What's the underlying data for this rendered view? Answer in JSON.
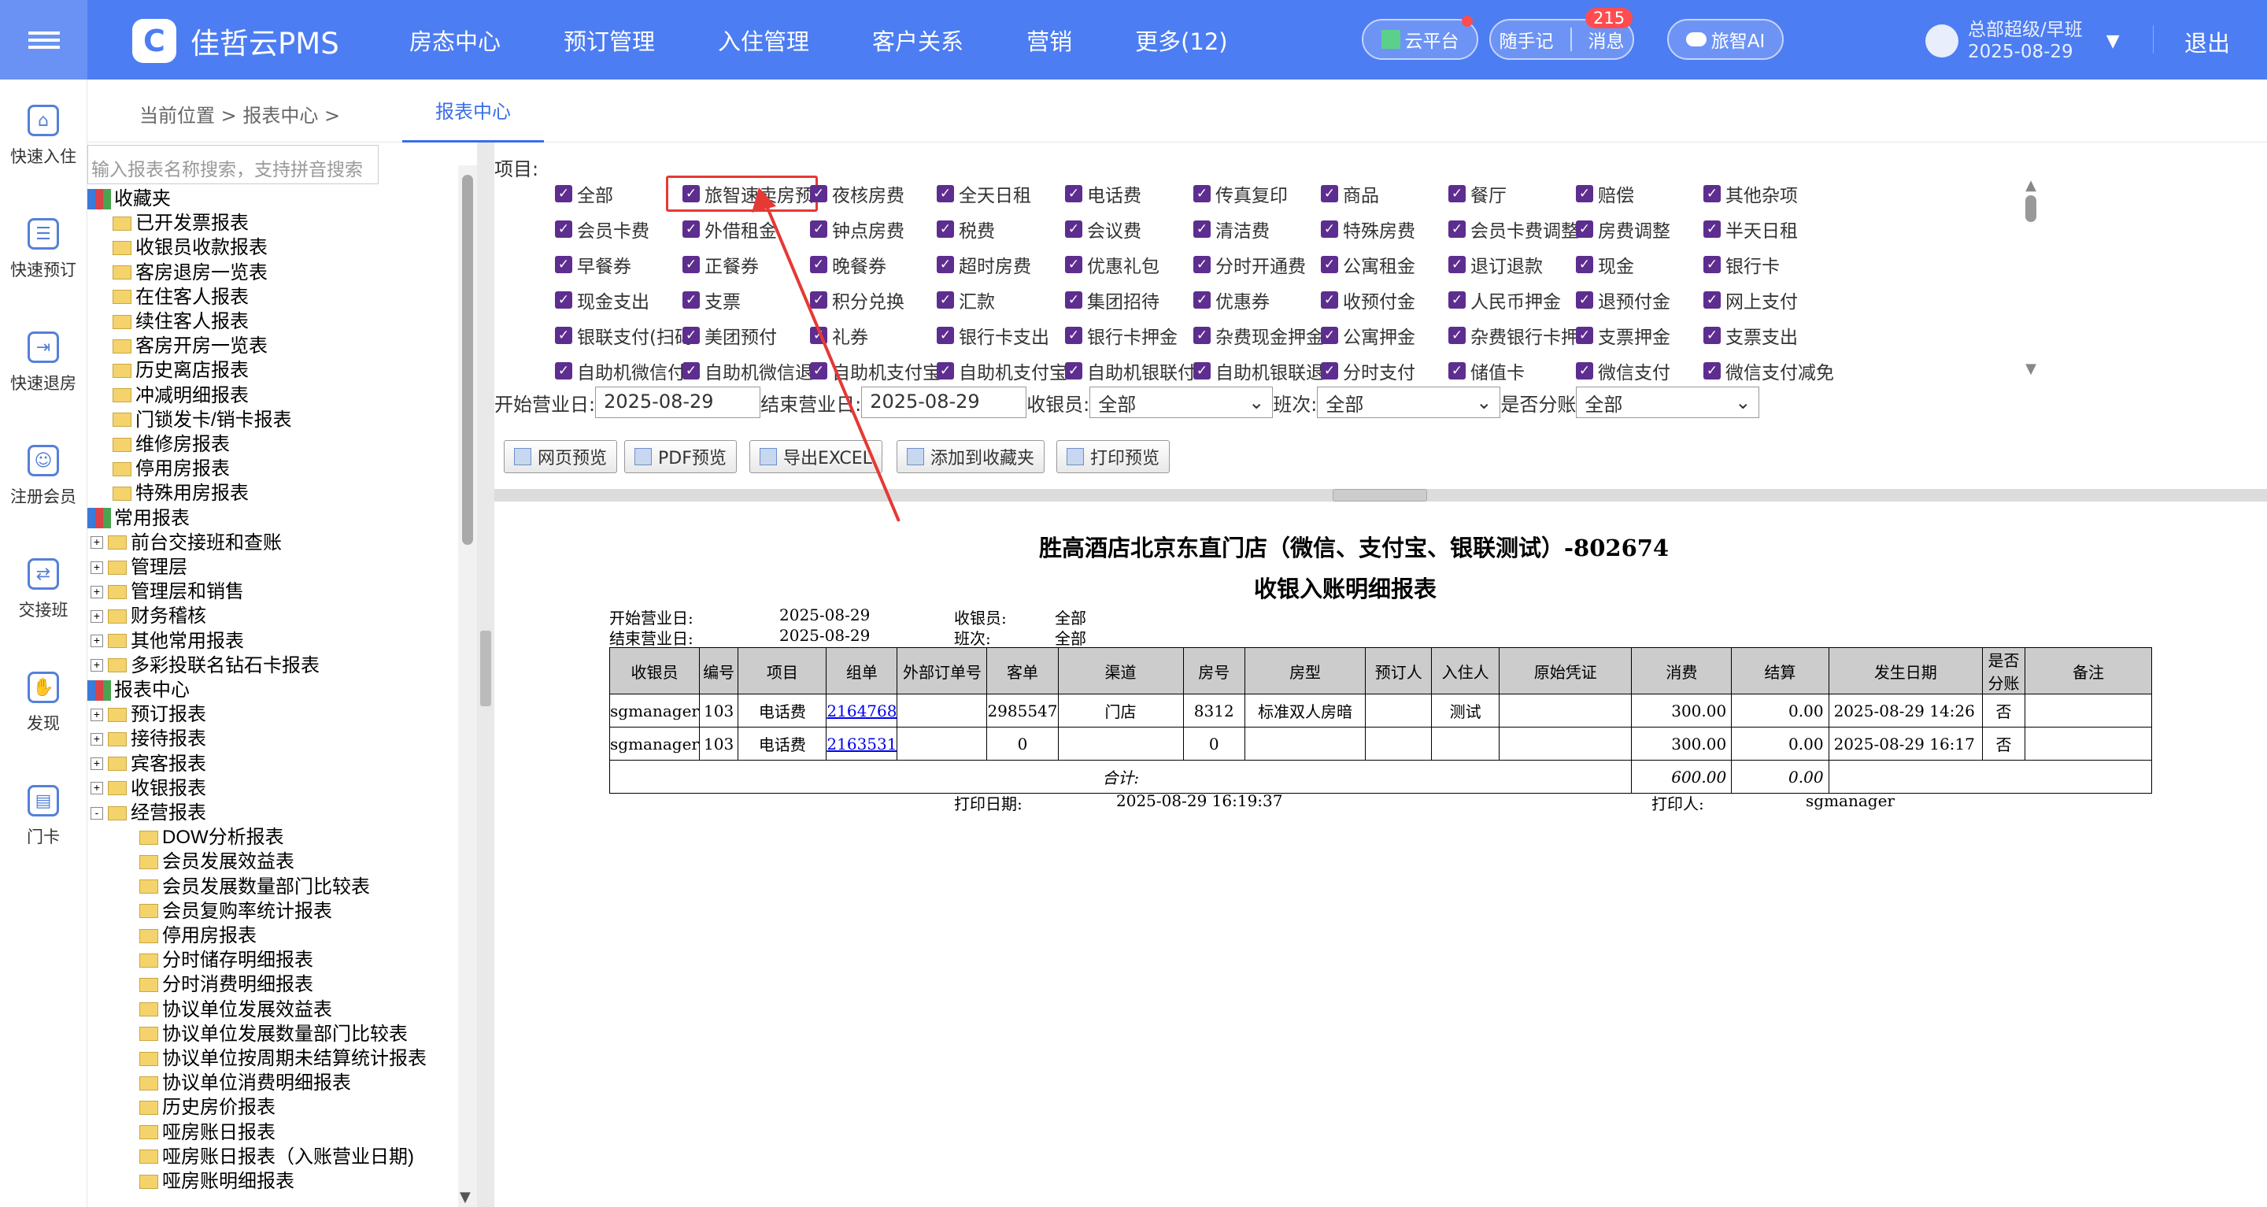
{
  "top": {
    "brand": "佳哲云PMS",
    "logo_glyph": "C",
    "nav": [
      "房态中心",
      "预订管理",
      "入住管理",
      "客户关系",
      "营销",
      "更多(12)"
    ],
    "cloud": "云平台",
    "note": "随手记",
    "msg": "消息",
    "msg_count": "215",
    "ai": "旅智AI",
    "user": "总部超级/早班",
    "date": "2025-08-29",
    "logout": "退出"
  },
  "side": [
    "快速入住",
    "快速预订",
    "快速退房",
    "注册会员",
    "交接班",
    "发现",
    "门卡"
  ],
  "crumb": {
    "text": "当前位置  >  报表中心  >",
    "tab": "报表中心"
  },
  "tree": {
    "search_placeholder": "输入报表名称搜索，支持拼音搜索",
    "fav": "收藏夹",
    "fav_items": [
      "已开发票报表",
      "收银员收款报表",
      "客房退房一览表",
      "在住客人报表",
      "续住客人报表",
      "客房开房一览表",
      "历史离店报表",
      "冲减明细报表",
      "门锁发卡/销卡报表",
      "维修房报表",
      "停用房报表",
      "特殊用房报表"
    ],
    "common": "常用报表",
    "common_items": [
      "前台交接班和查账",
      "管理层",
      "管理层和销售",
      "财务稽核",
      "其他常用报表",
      "多彩投联名钻石卡报表"
    ],
    "center": "报表中心",
    "center_items": [
      "预订报表",
      "接待报表",
      "宾客报表",
      "收银报表",
      "经营报表"
    ],
    "ops_items": [
      "DOW分析报表",
      "会员发展效益表",
      "会员发展数量部门比较表",
      "会员复购率统计报表",
      "停用房报表",
      "分时储存明细报表",
      "分时消费明细报表",
      "协议单位发展效益表",
      "协议单位发展数量部门比较表",
      "协议单位按周期未结算统计报表",
      "协议单位消费明细报表",
      "历史房价报表",
      "哑房账日报表",
      "哑房账日报表（入账营业日期)",
      "哑房账明细报表"
    ]
  },
  "filter": {
    "label": "项目:",
    "items": [
      [
        "全部",
        "旅智速卖房预",
        "夜核房费",
        "全天日租",
        "电话费",
        "传真复印",
        "商品",
        "餐厅",
        "赔偿",
        "其他杂项"
      ],
      [
        "会员卡费",
        "外借租金",
        "钟点房费",
        "税费",
        "会议费",
        "清洁费",
        "特殊房费",
        "会员卡费调整",
        "房费调整",
        "半天日租"
      ],
      [
        "早餐券",
        "正餐券",
        "晚餐券",
        "超时房费",
        "优惠礼包",
        "分时开通费",
        "公寓租金",
        "退订退款",
        "现金",
        "银行卡"
      ],
      [
        "现金支出",
        "支票",
        "积分兑换",
        "汇款",
        "集团招待",
        "优惠券",
        "收预付金",
        "人民币押金",
        "退预付金",
        "网上支付"
      ],
      [
        "银联支付(扫码",
        "美团预付",
        "礼券",
        "银行卡支出",
        "银行卡押金",
        "杂费现金押金",
        "公寓押金",
        "杂费银行卡押",
        "支票押金",
        "支票支出"
      ],
      [
        "自助机微信付",
        "自助机微信退",
        "自助机支付宝",
        "自助机支付宝",
        "自助机银联付",
        "自助机银联退",
        "分时支付",
        "储值卡",
        "微信支付",
        "微信支付减免"
      ]
    ],
    "start_label": "开始营业日:",
    "start": "2025-08-29",
    "end_label": "结束营业日:",
    "end": "2025-08-29",
    "cashier_label": "收银员:",
    "cashier": "全部",
    "shift_label": "班次:",
    "shift": "全部",
    "split_label": "是否分账",
    "split": "全部",
    "buttons": [
      "网页预览",
      "PDF预览",
      "导出EXCEL",
      "添加到收藏夹",
      "打印预览"
    ]
  },
  "report": {
    "hotel": "胜高酒店北京东直门店（微信、支付宝、银联测试）-802674",
    "title": "收银入账明细报表",
    "start_label": "开始营业日:",
    "start": "2025-08-29",
    "cashier_label": "收银员:",
    "cashier": "全部",
    "end_label": "结束营业日:",
    "end": "2025-08-29",
    "shift_label": "班次:",
    "shift": "全部",
    "headers": [
      "收银员",
      "编号",
      "项目",
      "组单",
      "外部订单号",
      "客单",
      "渠道",
      "房号",
      "房型",
      "预订人",
      "入住人",
      "原始凭证",
      "消费",
      "结算",
      "发生日期",
      "是否分账",
      "备注"
    ],
    "rows": [
      [
        "sgmanager",
        "103",
        "电话费",
        "2164768",
        "",
        "2985547",
        "门店",
        "8312",
        "标准双人房暗",
        "",
        "测试",
        "",
        "300.00",
        "0.00",
        "2025-08-29 14:26",
        "否",
        ""
      ],
      [
        "sgmanager",
        "103",
        "电话费",
        "2163531",
        "",
        "0",
        "",
        "0",
        "",
        "",
        "",
        "",
        "300.00",
        "0.00",
        "2025-08-29 16:17",
        "否",
        ""
      ]
    ],
    "total_label": "合计:",
    "total_consume": "600.00",
    "total_settle": "0.00",
    "print_date_label": "打印日期:",
    "print_date": "2025-08-29 16:19:37",
    "printer_label": "打印人:",
    "printer": "sgmanager"
  },
  "colors": {
    "header": "#4d7df2",
    "checkbox": "#5d2d8f",
    "highlight": "#e53935"
  }
}
